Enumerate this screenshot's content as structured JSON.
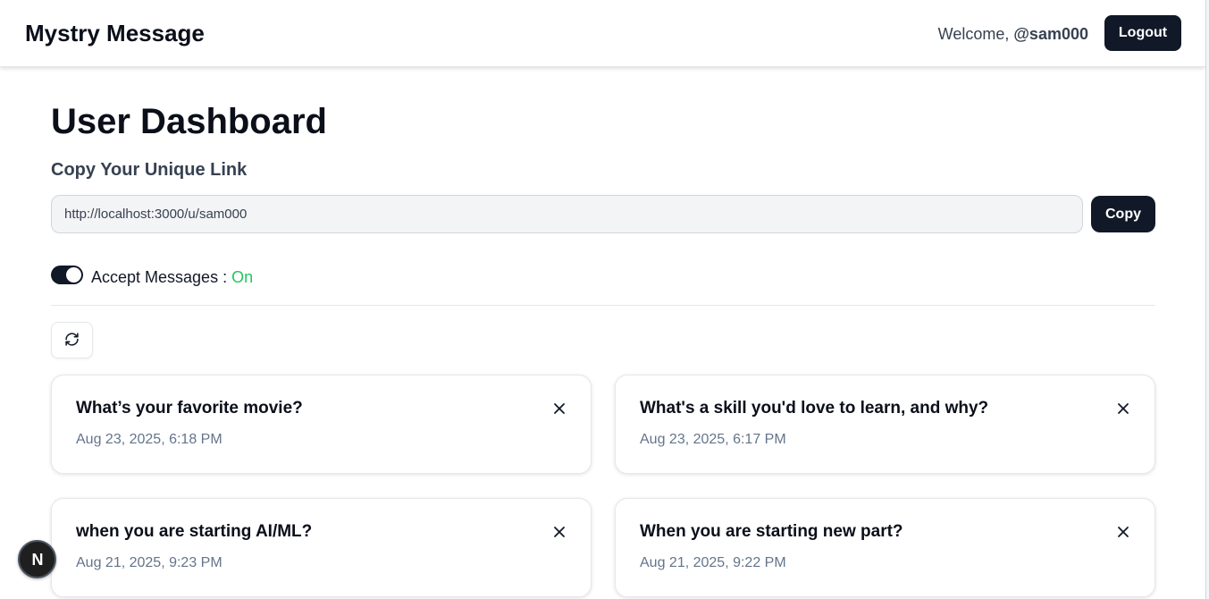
{
  "navbar": {
    "brand": "Mystry Message",
    "welcome_prefix": "Welcome, ",
    "username": "@sam000",
    "logout_label": "Logout"
  },
  "dashboard": {
    "title": "User Dashboard",
    "copy_section_label": "Copy Your Unique Link",
    "unique_link": "http://localhost:3000/u/sam000",
    "copy_label": "Copy",
    "accept_label": "Accept Messages : ",
    "accept_status": "On",
    "accept_enabled": true
  },
  "messages": [
    {
      "content": "What’s your favorite movie?",
      "date": "Aug 23, 2025, 6:18 PM"
    },
    {
      "content": "What's a skill you'd love to learn, and why?",
      "date": "Aug 23, 2025, 6:17 PM"
    },
    {
      "content": "when you are starting AI/ML?",
      "date": "Aug 21, 2025, 9:23 PM"
    },
    {
      "content": "When you are starting new part?",
      "date": "Aug 21, 2025, 9:22 PM"
    }
  ],
  "dev_badge": {
    "letter": "N"
  },
  "icons": {
    "refresh": "refresh-icon",
    "delete": "close-icon",
    "dev": "nextjs-logo-icon"
  },
  "colors": {
    "primary": "#111827",
    "status_on": "#22c55e",
    "muted_text": "#64748b"
  }
}
